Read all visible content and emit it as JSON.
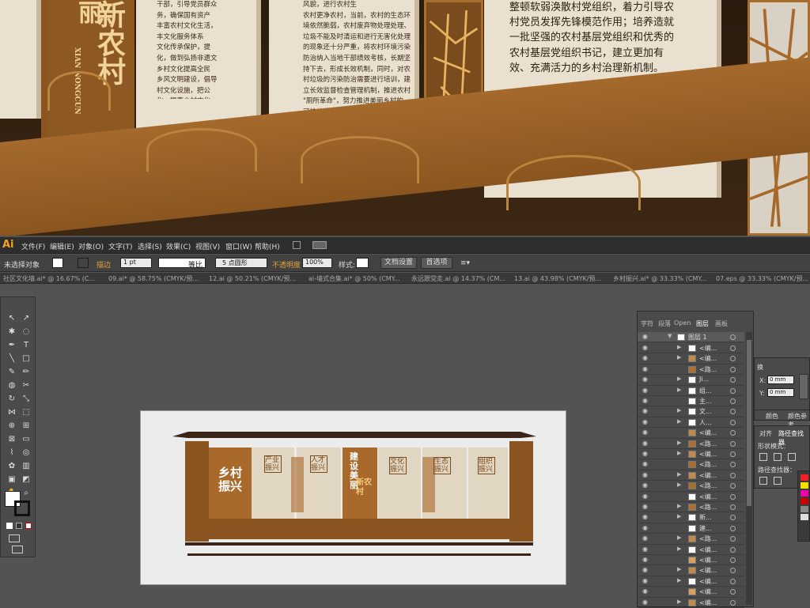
{
  "preview": {
    "top_text_1": "干部，引导党员群众\n务，确保国有资产\n丰富农村文化生活，\n丰文化服务体系\n文化传承保护，提\n化，做到弘扬非遗文\n乡村文化提高全民\n乡风文明建设，倡导\n村文化设施，把公\n化，提高乡村文化\n化，传承文化，打\n响。",
    "top_text_2": "风貌，进行农村生\n农村更净农村，当前，农村的生态环\n境依然脆弱，农村废弃物处理处理、\n垃圾不能及时清运和进行无害化处理\n的现象还十分严重，将农村环境污染\n防治纳入当地干部绩效考核，长期坚\n持下去，形成长效机制，同时，对农\n村垃圾的污染防治需要进行培训，建\n立长效监督检查管理机制，推进农村\n\"厕所革命\"，努力推进美丽乡村的\n可持续发展。",
    "top_text_3": "整顿软弱涣散村党组织，着力引导农\n村党员发挥先锋模范作用；培养造就\n一批坚强的农村基层党组织和优秀的\n农村基层党组织书记，建立更加有\n效、充满活力的乡村治理新机制。",
    "vertical_title": "新农村",
    "vertical_small": "丽",
    "vertical_pinyin": "XIAN NONGCUN"
  },
  "menubar": {
    "logo": "Ai",
    "items": [
      "文件(F)",
      "编辑(E)",
      "对象(O)",
      "文字(T)",
      "选择(S)",
      "效果(C)",
      "视图(V)",
      "窗口(W)",
      "帮助(H)"
    ]
  },
  "control": {
    "no_selection": "未选择对象",
    "stroke_label": "描边",
    "stroke_value": "1 pt",
    "equal_ratio": "等比",
    "brush": "5 点圆形",
    "opacity_label": "不透明度",
    "opacity_value": "100%",
    "style_label": "样式:",
    "doc_setup": "文档设置",
    "prefs": "首选项"
  },
  "doc_tabs": [
    "社区文化墙.ai* @ 16.67% (C...",
    "09.ai* @ 58.75% (CMYK/预...",
    "12.ai @ 50.21% (CMYK/预...",
    "ai-墙式合集.ai* @ 50% (CMY...",
    "永远跟党走.ai @ 14.37% (CM...",
    "13.ai @ 43.98% (CMYK/预...",
    "乡村振兴.ai* @ 33.33% (CMY...",
    "07.eps @ 33.33% (CMYK/预..."
  ],
  "panels": {
    "layers_tabs": [
      "字符",
      "段落",
      "Open",
      "图层",
      "画板"
    ],
    "layer_name": "图层 1",
    "layer_rows": [
      "<编...",
      "<编...",
      "<路...",
      "Ji...",
      "组...",
      "主...",
      "文...",
      "人...",
      "<编...",
      "<路...",
      "<编...",
      "<路...",
      "<编...",
      "<路...",
      "<编...",
      "<路...",
      "新...",
      "建...",
      "<路...",
      "<编...",
      "<编...",
      "<编...",
      "<编...",
      "<编...",
      "<编..."
    ],
    "transform_tab": "换",
    "x_field": "0 mm",
    "y_field": "0 mm",
    "color_tabs": [
      "颜色",
      "颜色参考"
    ],
    "pathfinder_tabs": [
      "对齐",
      "路径查找器"
    ],
    "shape_mode_label": "形状模式：",
    "pathfinder_label": "路径查找器："
  },
  "artboard": {
    "heading": "乡村振兴",
    "badges": [
      "产业振兴",
      "人才振兴",
      "文化振兴",
      "生态振兴",
      "组织振兴"
    ],
    "center_title": "建设美丽",
    "center_sub": "新农村"
  }
}
